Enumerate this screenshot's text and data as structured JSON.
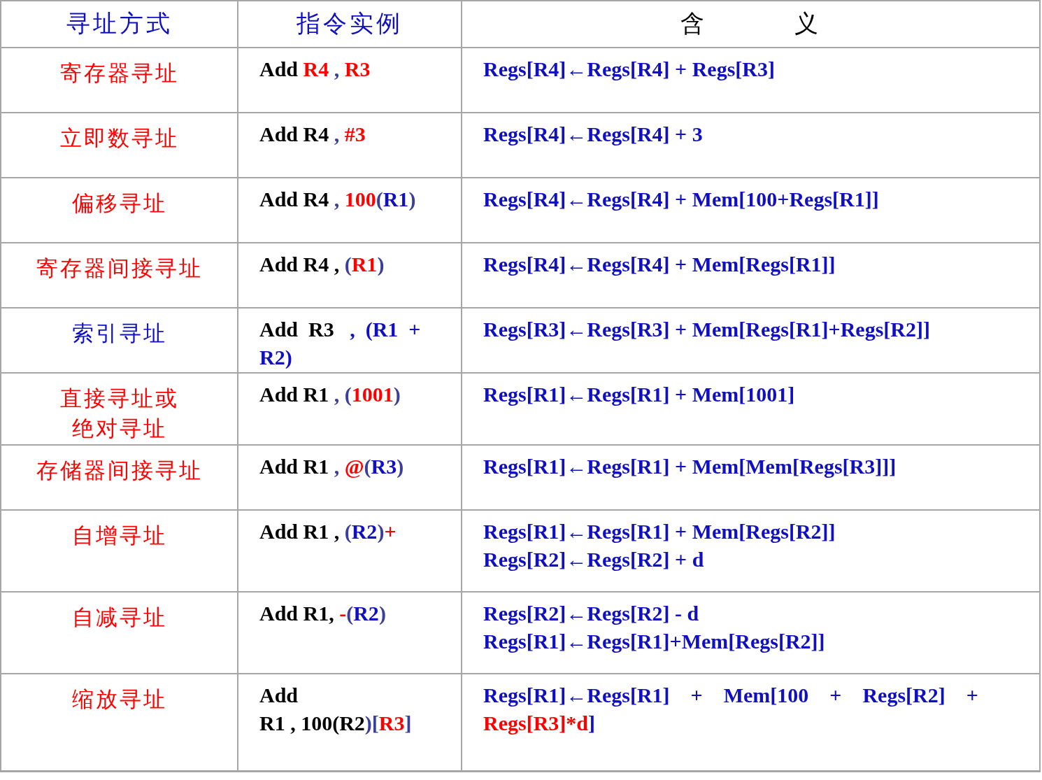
{
  "header": [
    {
      "text": "寻址方式",
      "color": "#1010c0"
    },
    {
      "text": "指令实例",
      "color": "#1010c0"
    },
    {
      "text": "含          义",
      "color": "#000000"
    }
  ],
  "rows": [
    {
      "mode": {
        "text": "寄存器寻址",
        "color": "#ff0000"
      },
      "instruction": [
        [
          {
            "text": "Add ",
            "color": "#000000"
          },
          {
            "text": "R4",
            "color": "#ff0000"
          },
          {
            "text": " , ",
            "color": "#3b3f9a"
          },
          {
            "text": "R3",
            "color": "#ff0000"
          }
        ]
      ],
      "meaning": [
        [
          {
            "text": "Regs[R4]←Regs[R4] + Regs[R3]",
            "color": "#1010c0"
          }
        ]
      ]
    },
    {
      "mode": {
        "text": "立即数寻址",
        "color": "#ff0000"
      },
      "instruction": [
        [
          {
            "text": "Add R4",
            "color": "#000000"
          },
          {
            "text": " , ",
            "color": "#3b3f9a"
          },
          {
            "text": "#3",
            "color": "#ff0000"
          }
        ]
      ],
      "meaning": [
        [
          {
            "text": "Regs[R4]←Regs[R4] + 3",
            "color": "#1010c0"
          }
        ]
      ]
    },
    {
      "mode": {
        "text": "偏移寻址",
        "color": "#ff0000"
      },
      "instruction": [
        [
          {
            "text": "Add R4",
            "color": "#000000"
          },
          {
            "text": " , ",
            "color": "#3b3f9a"
          },
          {
            "text": "100",
            "color": "#ff0000"
          },
          {
            "text": "(",
            "color": "#3b3f9a"
          },
          {
            "text": "R1",
            "color": "#1010c0"
          },
          {
            "text": ")",
            "color": "#3b3f9a"
          }
        ]
      ],
      "meaning": [
        [
          {
            "text": "Regs[R4]←Regs[R4] + Mem[100+Regs[R1]]",
            "color": "#1010c0"
          }
        ]
      ]
    },
    {
      "mode": {
        "text": "寄存器间接寻址",
        "color": "#ff0000"
      },
      "instruction": [
        [
          {
            "text": "Add R4 , ",
            "color": "#000000"
          },
          {
            "text": "(",
            "color": "#3b3f9a"
          },
          {
            "text": "R1",
            "color": "#ff0000"
          },
          {
            "text": ")",
            "color": "#3b3f9a"
          }
        ]
      ],
      "meaning": [
        [
          {
            "text": "Regs[R4]←Regs[R4] + Mem[Regs[R1]]",
            "color": "#1010c0"
          }
        ]
      ]
    },
    {
      "mode": {
        "text": "索引寻址",
        "color": "#1010c0"
      },
      "instruction": [
        [
          {
            "text": "Add  R3  ",
            "color": "#000000"
          },
          {
            "text": " ,  (R1  +",
            "color": "#1010c0"
          }
        ],
        [
          {
            "text": "R2)",
            "color": "#1010c0"
          }
        ]
      ],
      "meaning": [
        [
          {
            "text": "Regs[R3]←Regs[R3] + Mem[Regs[R1]+Regs[R2]]",
            "color": "#1010c0"
          }
        ]
      ]
    },
    {
      "mode": {
        "lines": [
          "直接寻址或",
          "绝对寻址"
        ],
        "color": "#ff0000"
      },
      "instruction": [
        [
          {
            "text": "Add R1",
            "color": "#000000"
          },
          {
            "text": " , (",
            "color": "#3b3f9a"
          },
          {
            "text": "1001",
            "color": "#ff0000"
          },
          {
            "text": ")",
            "color": "#3b3f9a"
          }
        ]
      ],
      "meaning": [
        [
          {
            "text": "Regs[R1]←Regs[R1] + Mem[1001]",
            "color": "#1010c0"
          }
        ]
      ]
    },
    {
      "mode": {
        "text": "存储器间接寻址",
        "color": "#ff0000"
      },
      "instruction": [
        [
          {
            "text": "Add R1",
            "color": "#000000"
          },
          {
            "text": " , ",
            "color": "#3b3f9a"
          },
          {
            "text": "@",
            "color": "#ff0000"
          },
          {
            "text": "(",
            "color": "#3b3f9a"
          },
          {
            "text": "R3",
            "color": "#1010c0"
          },
          {
            "text": ")",
            "color": "#3b3f9a"
          }
        ]
      ],
      "meaning": [
        [
          {
            "text": "Regs[R1]←Regs[R1] + Mem[Mem[Regs[R3]]]",
            "color": "#1010c0"
          }
        ]
      ]
    },
    {
      "mode": {
        "text": "自增寻址",
        "color": "#ff0000"
      },
      "instruction": [
        [
          {
            "text": "Add R1 , ",
            "color": "#000000"
          },
          {
            "text": "(",
            "color": "#3b3f9a"
          },
          {
            "text": "R2",
            "color": "#1010c0"
          },
          {
            "text": ")",
            "color": "#3b3f9a"
          },
          {
            "text": "+",
            "color": "#ff0000"
          }
        ]
      ],
      "meaning": [
        [
          {
            "text": "Regs[R1]←Regs[R1] + Mem[Regs[R2]]",
            "color": "#1010c0"
          }
        ],
        [
          {
            "text": "Regs[R2]←Regs[R2] + d",
            "color": "#1010c0"
          }
        ]
      ]
    },
    {
      "mode": {
        "text": "自减寻址",
        "color": "#ff0000"
      },
      "instruction": [
        [
          {
            "text": "Add R1, ",
            "color": "#000000"
          },
          {
            "text": "-",
            "color": "#ff0000"
          },
          {
            "text": "(",
            "color": "#3b3f9a"
          },
          {
            "text": "R2",
            "color": "#1010c0"
          },
          {
            "text": ")",
            "color": "#3b3f9a"
          }
        ]
      ],
      "meaning": [
        [
          {
            "text": "Regs[R2]←Regs[R2] - d",
            "color": "#1010c0"
          }
        ],
        [
          {
            "text": "Regs[R1]←Regs[R1]+Mem[Regs[R2]]",
            "color": "#1010c0"
          }
        ]
      ]
    },
    {
      "mode": {
        "text": "缩放寻址",
        "color": "#ff0000"
      },
      "instruction": [
        [
          {
            "text": "Add",
            "color": "#000000"
          }
        ],
        [
          {
            "text": "R1 , 100(R2",
            "color": "#000000"
          },
          {
            "text": ")[",
            "color": "#3b3f9a"
          },
          {
            "text": "R3",
            "color": "#ff0000"
          },
          {
            "text": "]",
            "color": "#3b3f9a"
          }
        ]
      ],
      "meaning": [
        [
          {
            "text": "Regs[R1]←Regs[R1]    +    Mem[100    +    Regs[R2]    +",
            "color": "#1010c0"
          }
        ],
        [
          {
            "text": "Regs[R3]*d",
            "color": "#ff0000"
          },
          {
            "text": "]",
            "color": "#1010c0"
          }
        ]
      ]
    }
  ]
}
